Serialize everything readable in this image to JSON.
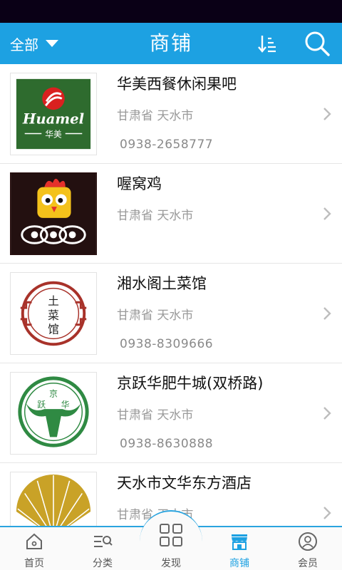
{
  "header": {
    "filter_label": "全部",
    "title": "商铺"
  },
  "shops": [
    {
      "name": "华美西餐休闲果吧",
      "region": "甘肃省 天水市",
      "phone": "0938-2658777",
      "logo": "huamei-logo",
      "logo_text": "Huamel",
      "logo_sub": "华美"
    },
    {
      "name": "喔窝鸡",
      "region": "甘肃省 天水市",
      "phone": "",
      "logo": "rooster-logo"
    },
    {
      "name": "湘水阁土菜馆",
      "region": "甘肃省 天水市",
      "phone": "0938-8309666",
      "logo": "xiangshuige-logo",
      "logo_text": "土菜馆"
    },
    {
      "name": "京跃华肥牛城(双桥路)",
      "region": "甘肃省 天水市",
      "phone": "0938-8630888",
      "logo": "jingyuehua-logo",
      "logo_text": "京跃华"
    },
    {
      "name": "天水市文华东方酒店",
      "region": "甘肃省 天水市",
      "phone": "",
      "logo": "fan-logo"
    }
  ],
  "tabs": [
    {
      "label": "首页",
      "icon": "home-icon"
    },
    {
      "label": "分类",
      "icon": "category-icon"
    },
    {
      "label": "发现",
      "icon": "discover-icon"
    },
    {
      "label": "商铺",
      "icon": "shop-icon",
      "active": true
    },
    {
      "label": "会员",
      "icon": "member-icon"
    }
  ],
  "colors": {
    "brand": "#1da1e2",
    "status_bar": "#0a0016",
    "huamei_green": "#2e6b2e",
    "huamei_red": "#d9201f",
    "xiangshuige_red": "#a8322a",
    "jingyuehua_green": "#2f8a43"
  }
}
